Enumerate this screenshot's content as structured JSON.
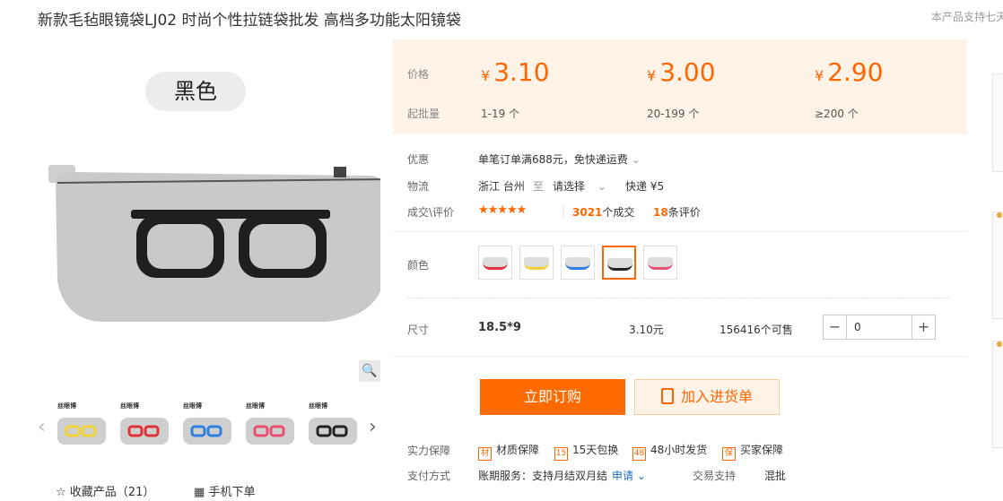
{
  "product": {
    "title": "新款毛毡眼镜袋LJ02 时尚个性拉链袋批发 高档多功能太阳镜袋",
    "support_text": "本产品支持七天"
  },
  "gallery": {
    "color_tag": "黑色",
    "zoom_icon": "magnifier-icon",
    "thumb_brand": "丝眼博",
    "thumbs": [
      {
        "color": "#f2d23a"
      },
      {
        "color": "#e0323a"
      },
      {
        "color": "#2f7fe0"
      },
      {
        "color": "#e85070"
      },
      {
        "color": "#222222"
      }
    ],
    "favorite_label": "收藏产品（21）",
    "mobile_label": "手机下单"
  },
  "pricing": {
    "price_label": "价格",
    "moq_label": "起批量",
    "currency": "¥",
    "tiers": [
      {
        "price": "3.10",
        "qty": "1-19 个"
      },
      {
        "price": "3.00",
        "qty": "20-199 个"
      },
      {
        "price": "2.90",
        "qty": "≥200 个"
      }
    ]
  },
  "info": {
    "discount_label": "优惠",
    "discount_text": "单笔订单满688元，免快递运费",
    "logistics_label": "物流",
    "origin": "浙江 台州",
    "to": "至",
    "destination": "请选择",
    "shipping": "快递 ¥5",
    "deals_label": "成交\\评价",
    "deals_count": "3021",
    "deals_suffix": "个成交",
    "review_count": "18",
    "review_suffix": "条评价",
    "rating": 4.5
  },
  "colors": {
    "label": "颜色",
    "swatches": [
      {
        "color": "#e0323a"
      },
      {
        "color": "#f2d23a"
      },
      {
        "color": "#2f7fe0"
      },
      {
        "color": "#222222"
      },
      {
        "color": "#e85070"
      }
    ],
    "selected_index": 3
  },
  "size": {
    "label": "尺寸",
    "value": "18.5*9",
    "price": "3.10元",
    "stock": "156416个可售",
    "quantity": "0"
  },
  "actions": {
    "buy_now": "立即订购",
    "add_to_cart": "加入进货单"
  },
  "guarantee": {
    "label": "实力保障",
    "items": [
      {
        "icon": "材",
        "text": "材质保障"
      },
      {
        "icon": "15",
        "text": "15天包换"
      },
      {
        "icon": "48",
        "text": "48小时发货"
      },
      {
        "icon": "保",
        "text": "买家保障"
      }
    ]
  },
  "payment": {
    "label": "支付方式",
    "text": "账期服务：支持月结双月结",
    "apply": "申请",
    "trade_label": "交易支持",
    "trade_value": "混批"
  },
  "theme": {
    "accent": "#ff6600",
    "price_bg": "#fff3e8"
  }
}
